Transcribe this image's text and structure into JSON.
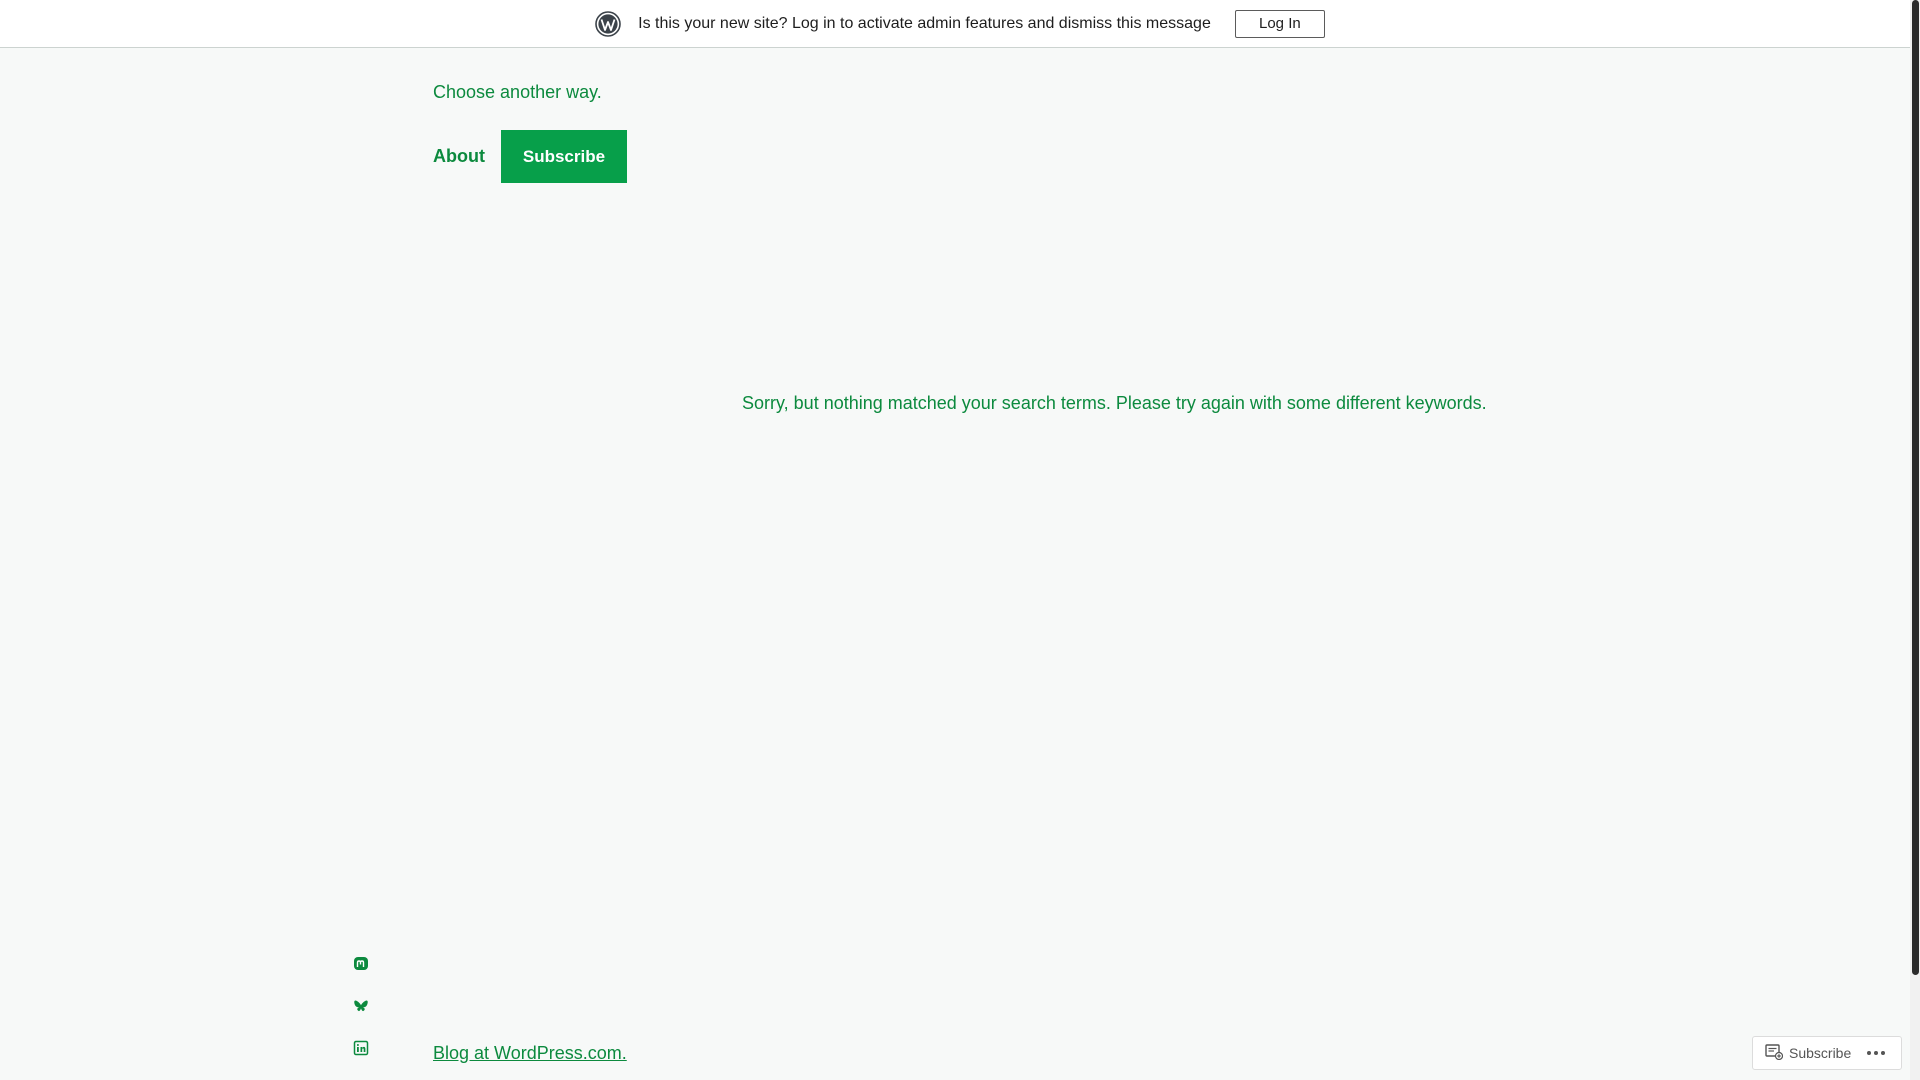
{
  "admin_bar": {
    "message": "Is this your new site? Log in to activate admin features and dismiss this message",
    "login_label": "Log In",
    "logo_icon": "wordpress-logo-icon"
  },
  "header": {
    "tagline": "Choose another way.",
    "nav": {
      "about_label": "About",
      "subscribe_label": "Subscribe"
    }
  },
  "main": {
    "no_results_message": "Sorry, but nothing matched your search terms. Please try again with some different keywords."
  },
  "footer": {
    "social_icons": [
      "mastodon-icon",
      "bluesky-icon",
      "linkedin-icon"
    ],
    "credit": "Blog at WordPress.com."
  },
  "floating_subscribe": {
    "label": "Subscribe",
    "icon": "reader-subscribe-icon",
    "more_icon": "more-dots-icon"
  },
  "colors": {
    "accent": "#0c8a3e",
    "button_bg": "#079f4a",
    "background": "#f7f9f8"
  }
}
